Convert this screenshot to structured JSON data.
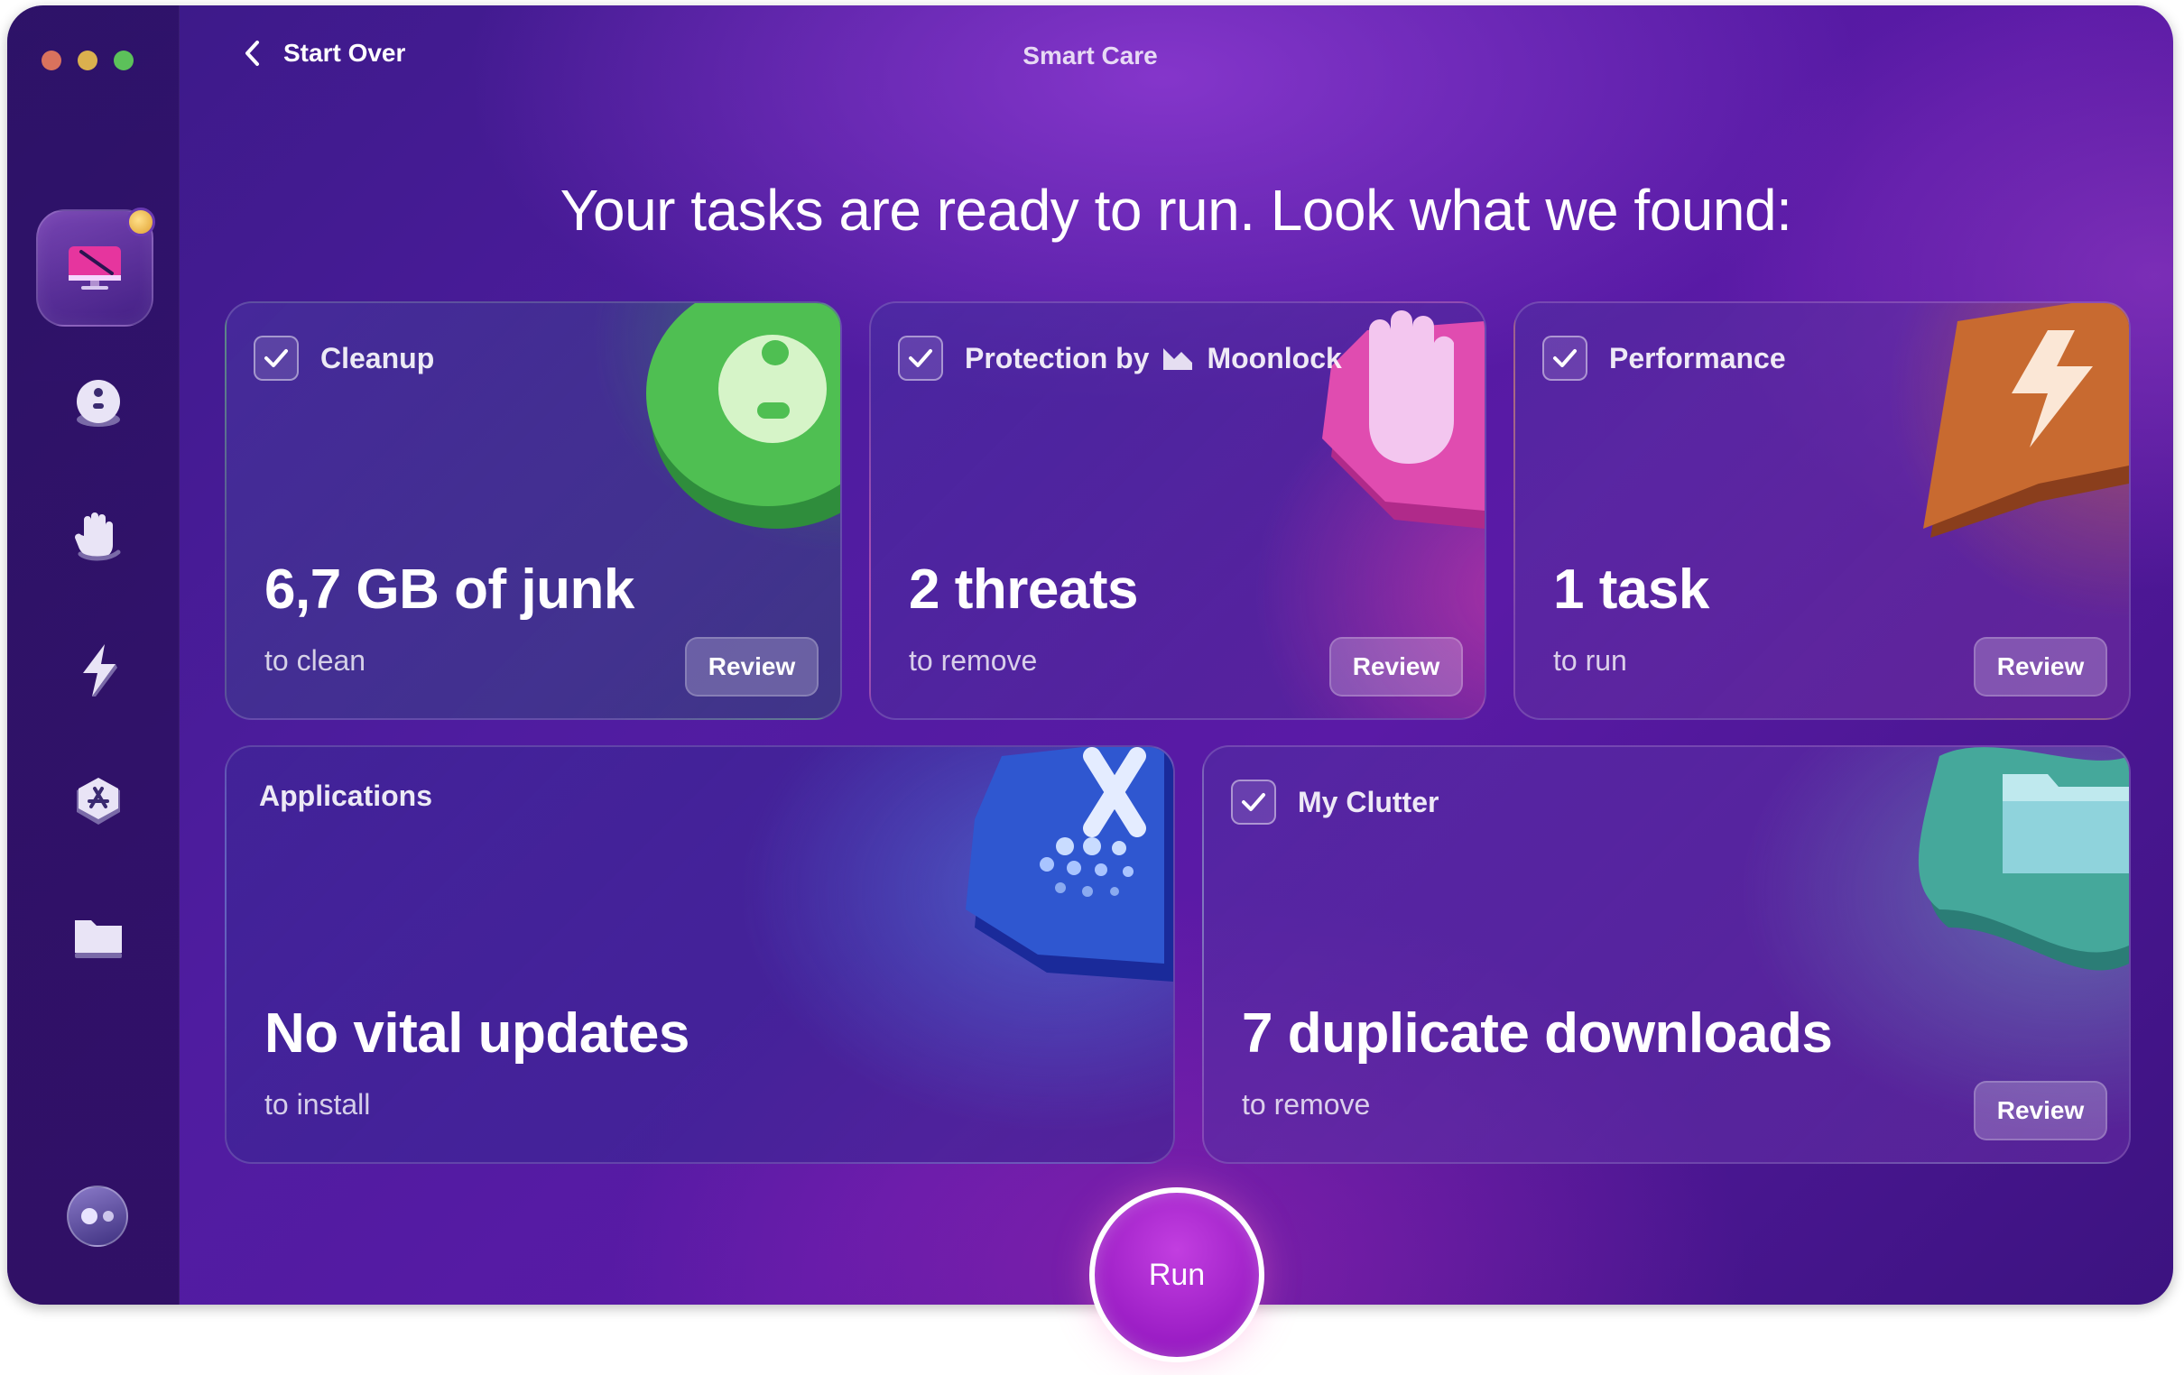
{
  "window": {
    "title": "Smart Care",
    "back_label": "Start Over"
  },
  "headline": "Your tasks are ready to run. Look what we found:",
  "sidebar": {
    "items": [
      {
        "name": "smart-care",
        "icon": "monitor-icon",
        "active": true
      },
      {
        "name": "cleanup",
        "icon": "disc-icon"
      },
      {
        "name": "protection",
        "icon": "hand-icon"
      },
      {
        "name": "performance",
        "icon": "bolt-icon"
      },
      {
        "name": "applications",
        "icon": "app-store-icon"
      },
      {
        "name": "my-clutter",
        "icon": "folder-icon"
      }
    ],
    "assistant_icon": "assistant-icon"
  },
  "cards": {
    "cleanup": {
      "title": "Cleanup",
      "checked": true,
      "main": "6,7 GB of junk",
      "sub": "to clean",
      "review": "Review"
    },
    "protection": {
      "title_prefix": "Protection by",
      "title_brand": "Moonlock",
      "checked": true,
      "main": "2 threats",
      "sub": "to remove",
      "review": "Review"
    },
    "performance": {
      "title": "Performance",
      "checked": true,
      "main": "1 task",
      "sub": "to run",
      "review": "Review"
    },
    "applications": {
      "title": "Applications",
      "main": "No vital updates",
      "sub": "to install"
    },
    "clutter": {
      "title": "My Clutter",
      "checked": true,
      "main": "7 duplicate downloads",
      "sub": "to remove",
      "review": "Review"
    }
  },
  "run_label": "Run",
  "colors": {
    "accent": "#a322d0",
    "cleanup": "#3fa848",
    "protection": "#c33ca0",
    "performance": "#c3642a",
    "applications": "#2a4fc0",
    "clutter": "#3aa8a0"
  }
}
